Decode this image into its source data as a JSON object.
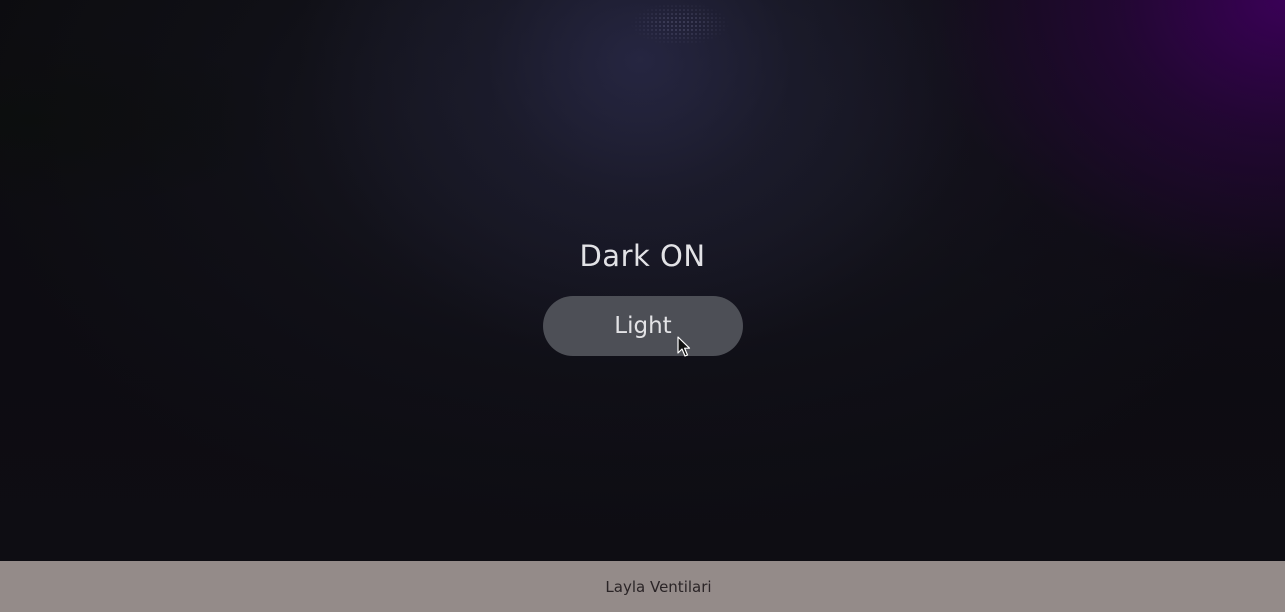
{
  "main": {
    "heading": "Dark ON",
    "toggle_label": "Light"
  },
  "footer": {
    "author": "Layla Ventilari"
  },
  "icons": {
    "cursor": "mouse-pointer-icon"
  },
  "colors": {
    "button_bg": "#4d4f56",
    "footer_bg": "#948b89",
    "accent_purple": "#3c005a",
    "page_bg": "#0e0d13"
  }
}
